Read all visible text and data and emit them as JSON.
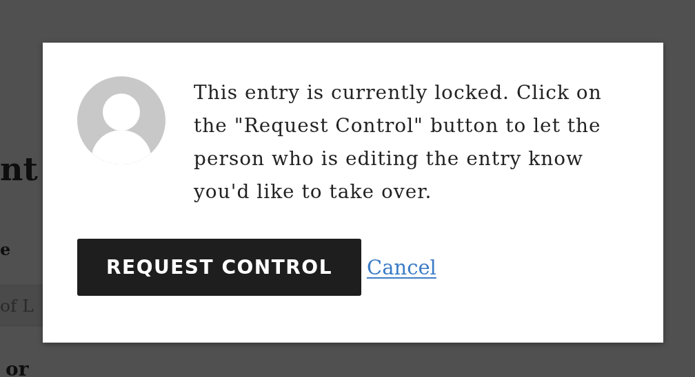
{
  "background_page": {
    "heading": "nt",
    "field_label": "e",
    "field_value": "of L",
    "second_label": "or"
  },
  "dialog": {
    "message": "This entry is currently locked. Click on the \"Request Control\" button to let the person who is editing the entry know you'd like to take over.",
    "primary_button": "REQUEST CONTROL",
    "cancel_link": "Cancel"
  }
}
